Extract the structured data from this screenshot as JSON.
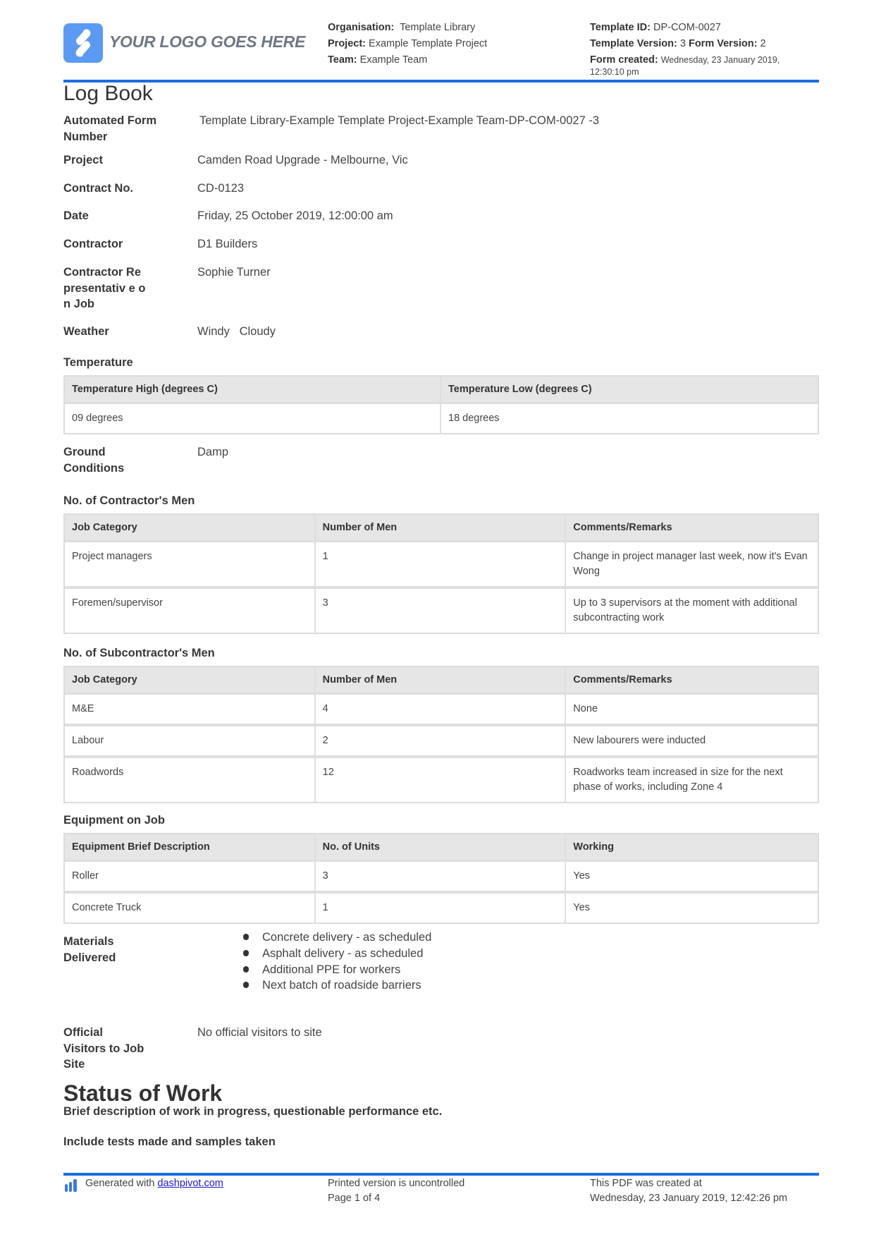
{
  "header": {
    "logo_text": "YOUR LOGO GOES HERE",
    "organisation_label": "Organisation:",
    "organisation_value": "Template Library",
    "project_label": "Project:",
    "project_value": "Example Template Project",
    "team_label": "Team:",
    "team_value": "Example Team",
    "template_id_label": "Template ID:",
    "template_id_value": "DP-COM-0027",
    "template_version_label": "Template Version:",
    "template_version_value": "3",
    "form_version_label": "Form Version:",
    "form_version_value": "2",
    "form_created_label": "Form created:",
    "form_created_value": "Wednesday, 23 January 2019, 12:30:10 pm",
    "accent_color": "#1a6ee0"
  },
  "title": "Log Book",
  "fields": {
    "automated_form_number": {
      "label": "Automated Form Number",
      "value": "Template Library-Example Template Project-Example Team-DP-COM-0027   -3"
    },
    "project": {
      "label": "Project",
      "value": "Camden Road Upgrade - Melbourne, Vic"
    },
    "contract_no": {
      "label": "Contract No.",
      "value": "CD-0123"
    },
    "date": {
      "label": "Date",
      "value": "Friday, 25 October 2019, 12:00:00 am"
    },
    "contractor": {
      "label": "Contractor",
      "value": "D1 Builders"
    },
    "contractor_rep": {
      "label": "Contractor Representativ e on Job",
      "value": "Sophie Turner"
    },
    "weather": {
      "label": "Weather",
      "value": "Windy   Cloudy"
    },
    "ground_conditions": {
      "label": "Ground Conditions",
      "value": "Damp"
    },
    "official_visitors": {
      "label": "Official Visitors to Job Site",
      "value": "No official visitors to site"
    },
    "materials_delivered": {
      "label": "Materials Delivered",
      "items": [
        "Concrete delivery - as scheduled",
        "Asphalt delivery - as scheduled",
        "Additional PPE for workers",
        "Next batch of roadside barriers"
      ]
    }
  },
  "temperature": {
    "title": "Temperature",
    "headers": [
      "Temperature High (degrees C)",
      "Temperature Low (degrees C)"
    ],
    "rows": [
      [
        "09 degrees",
        "18 degrees"
      ]
    ]
  },
  "contractors_men": {
    "title": "No. of Contractor's Men",
    "headers": [
      "Job Category",
      "Number of Men",
      "Comments/Remarks"
    ],
    "rows": [
      [
        "Project managers",
        "1",
        "Change in project manager last week, now it's Evan Wong"
      ],
      [
        "Foremen/supervisor",
        "3",
        "Up to 3 supervisors at the moment with additional subcontracting work"
      ]
    ]
  },
  "subcontractors_men": {
    "title": "No. of Subcontractor's Men",
    "headers": [
      "Job Category",
      "Number of Men",
      "Comments/Remarks"
    ],
    "rows": [
      [
        "M&E",
        "4",
        "None"
      ],
      [
        "Labour",
        "2",
        "New labourers were inducted"
      ],
      [
        "Roadwords",
        "12",
        "Roadworks team increased in size for the next phase of works, including Zone 4"
      ]
    ]
  },
  "equipment": {
    "title": "Equipment on Job",
    "headers": [
      "Equipment Brief Description",
      "No. of Units",
      "Working"
    ],
    "rows": [
      [
        "Roller",
        "3",
        "Yes"
      ],
      [
        "Concrete Truck",
        "1",
        "Yes"
      ]
    ]
  },
  "status_of_work": {
    "title": "Status of Work",
    "subtitle": "Brief description of work in progress, questionable performance etc.",
    "subtitle2": "Include tests made and samples taken"
  },
  "footer": {
    "generated_prefix": "Generated with",
    "generated_link": "dashpivot.com",
    "printed_notice": "Printed version is uncontrolled",
    "page_info": "Page 1 of 4",
    "pdf_created_label": "This PDF was created at",
    "pdf_created_value": "Wednesday, 23 January 2019, 12:42:26 pm"
  }
}
